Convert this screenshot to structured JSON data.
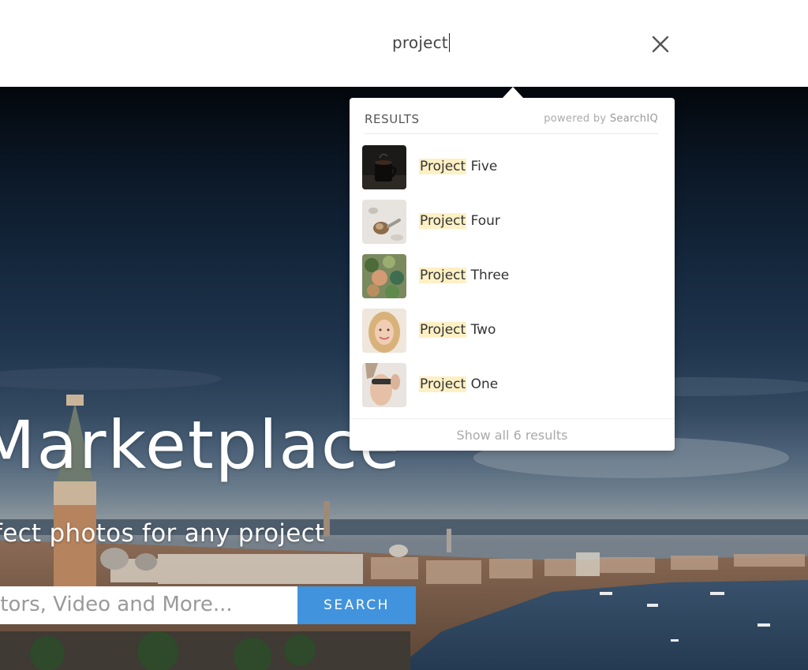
{
  "search": {
    "query": "project",
    "close_icon": "close-x-icon"
  },
  "hero": {
    "title": "Marketplace",
    "subtitle": "fect photos for any project",
    "input_placeholder": "ctors, Video and More...",
    "search_button": "SEARCH",
    "accent_color": "#4193dd"
  },
  "results": {
    "header_label": "RESULTS",
    "powered_prefix": "powered by",
    "powered_brand": "SearchIQ",
    "highlight": "Project",
    "items": [
      {
        "match": "Project",
        "rest": " Five"
      },
      {
        "match": "Project",
        "rest": " Four"
      },
      {
        "match": "Project",
        "rest": " Three"
      },
      {
        "match": "Project",
        "rest": " Two"
      },
      {
        "match": "Project",
        "rest": " One"
      }
    ],
    "show_all": "Show all 6 results"
  }
}
